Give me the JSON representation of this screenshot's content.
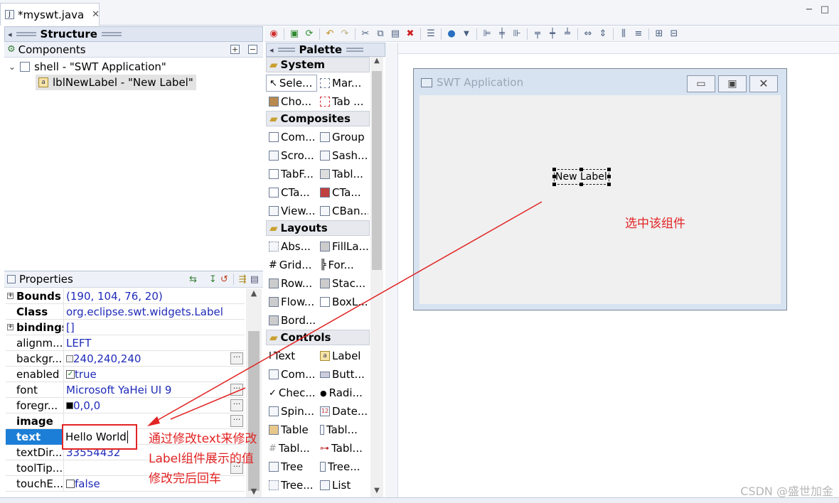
{
  "editor": {
    "tab_title": "*myswt.java",
    "close_glyph": "✕"
  },
  "structure": {
    "title": "Structure",
    "components_label": "Components",
    "tree": [
      {
        "label": "shell - \"SWT Application\""
      },
      {
        "label": "lblNewLabel - \"New Label\""
      }
    ]
  },
  "properties": {
    "title": "Properties",
    "rows": [
      {
        "name": "Bounds",
        "value": "(190, 104, 76, 20)"
      },
      {
        "name": "Class",
        "value": "org.eclipse.swt.widgets.Label"
      },
      {
        "name": "bindings",
        "value": "[]"
      },
      {
        "name": "alignm...",
        "value": "LEFT"
      },
      {
        "name": "backgr...",
        "value": "240,240,240"
      },
      {
        "name": "enabled",
        "value": "true"
      },
      {
        "name": "font",
        "value": "Microsoft YaHei UI 9"
      },
      {
        "name": "foregr...",
        "value": "0,0,0"
      },
      {
        "name": "image",
        "value": ""
      },
      {
        "name": "text",
        "value": "Hello World"
      },
      {
        "name": "textDir...",
        "value": "33554432"
      },
      {
        "name": "toolTip...",
        "value": ""
      },
      {
        "name": "touchE...",
        "value": "false"
      }
    ]
  },
  "palette": {
    "title": "Palette",
    "categories": [
      {
        "name": "System",
        "items": [
          "Sele...",
          "Mar...",
          "Cho...",
          "Tab ..."
        ]
      },
      {
        "name": "Composites",
        "items": [
          "Com...",
          "Group",
          "Scro...",
          "Sash...",
          "TabF...",
          "Tabl...",
          "CTa...",
          "CTa...",
          "View...",
          "CBan..."
        ]
      },
      {
        "name": "Layouts",
        "items": [
          "Abs...",
          "FillLa...",
          "Grid...",
          "For...",
          "Row...",
          "Stac...",
          "Flow...",
          "BoxL...",
          "Bord..."
        ]
      },
      {
        "name": "Controls",
        "items": [
          "Text",
          "Label",
          "Com...",
          "Butt...",
          "Chec...",
          "Radi...",
          "Spin...",
          "Date...",
          "Table",
          "Tabl...",
          "Tabl...",
          "Tabl...",
          "Tree",
          "Tree...",
          "Tree...",
          "List"
        ]
      }
    ]
  },
  "design": {
    "shell_title": "SWT Application",
    "label_text": "New Label"
  },
  "annotations": {
    "select_component": "选中该组件",
    "line1": "通过修改text来修改",
    "line2": "Label组件展示的值",
    "line3": "修改完后回车"
  },
  "watermark": "CSDN @盛世加金"
}
